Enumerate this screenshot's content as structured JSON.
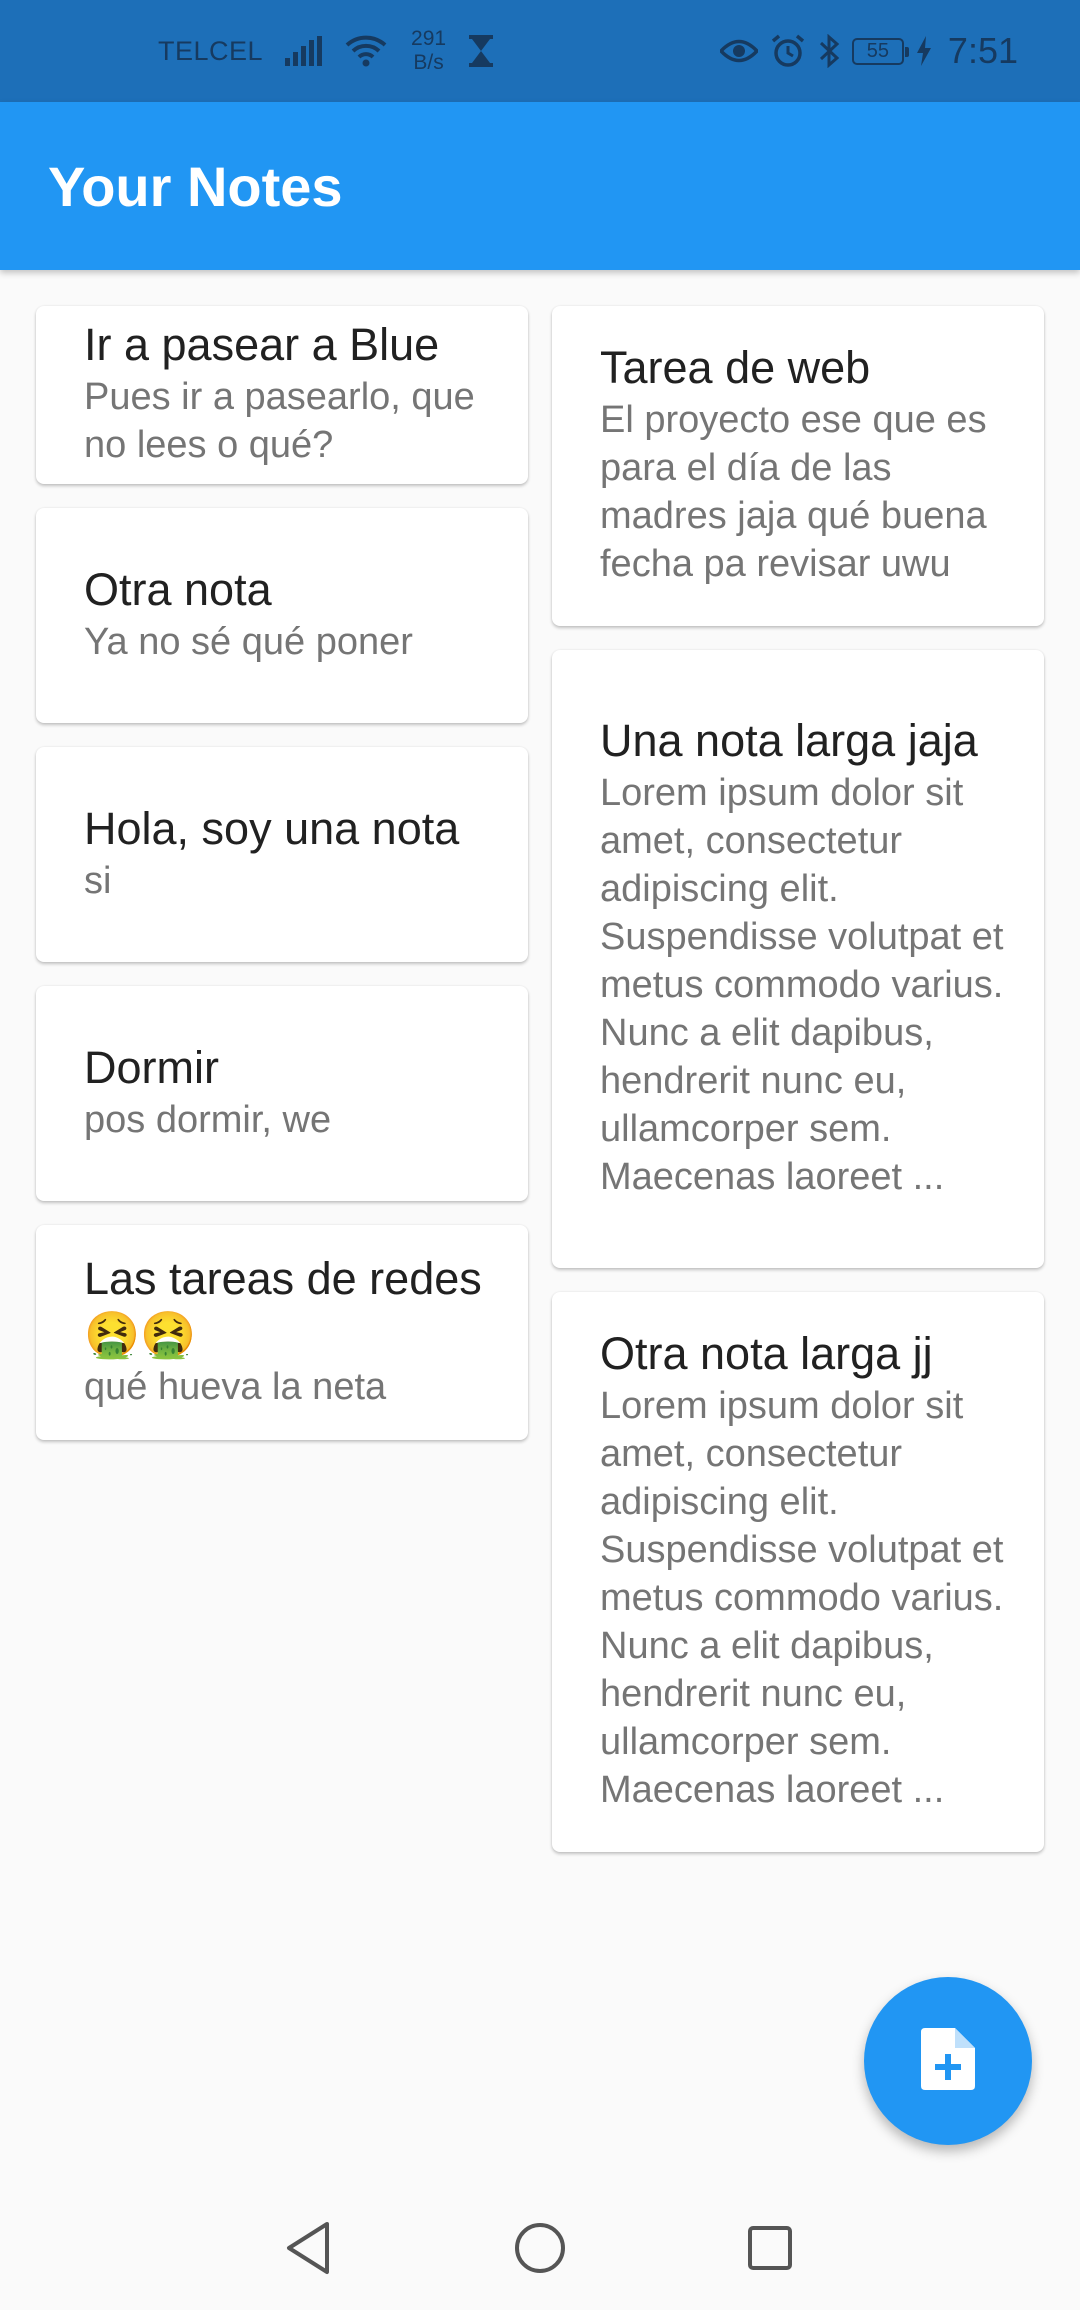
{
  "status_bar": {
    "carrier": "TELCEL",
    "net_speed_value": "291",
    "net_speed_unit": "B/s",
    "battery": "55",
    "time": "7:51"
  },
  "app_bar": {
    "title": "Your Notes"
  },
  "notes_left": [
    {
      "title": "Ir a pasear a Blue",
      "body": "Pues ir a pasearlo, que no lees o qué?"
    },
    {
      "title": "Otra nota",
      "body": "Ya no sé qué poner"
    },
    {
      "title": "Hola, soy una nota",
      "body": "si"
    },
    {
      "title": "Dormir",
      "body": "pos dormir, we"
    },
    {
      "title": "Las tareas de redes 🤮🤮",
      "body": "qué hueva la neta"
    }
  ],
  "notes_right": [
    {
      "title": "Tarea de web",
      "body": "El proyecto ese que es para el día de las madres jaja qué buena fecha pa revisar uwu"
    },
    {
      "title": "Una nota larga jaja",
      "body": "Lorem ipsum dolor sit amet, consectetur adipiscing elit. Suspendisse volutpat et metus commodo varius. Nunc a elit dapibus, hendrerit nunc eu, ullamcorper sem. Maecenas laoreet ..."
    },
    {
      "title": "Otra nota larga jj",
      "body": "Lorem ipsum dolor sit amet, consectetur adipiscing elit. Suspendisse volutpat et metus commodo varius. Nunc a elit dapibus, hendrerit nunc eu, ullamcorper sem. Maecenas laoreet ..."
    }
  ],
  "fab": {
    "icon": "note-add-icon"
  },
  "nav": {
    "back_icon": "back-icon",
    "home_icon": "home-icon",
    "recents_icon": "recents-icon"
  },
  "colors": {
    "primary": "#2196f3",
    "status_bar": "#1d6fb8",
    "background": "#fafafa"
  }
}
